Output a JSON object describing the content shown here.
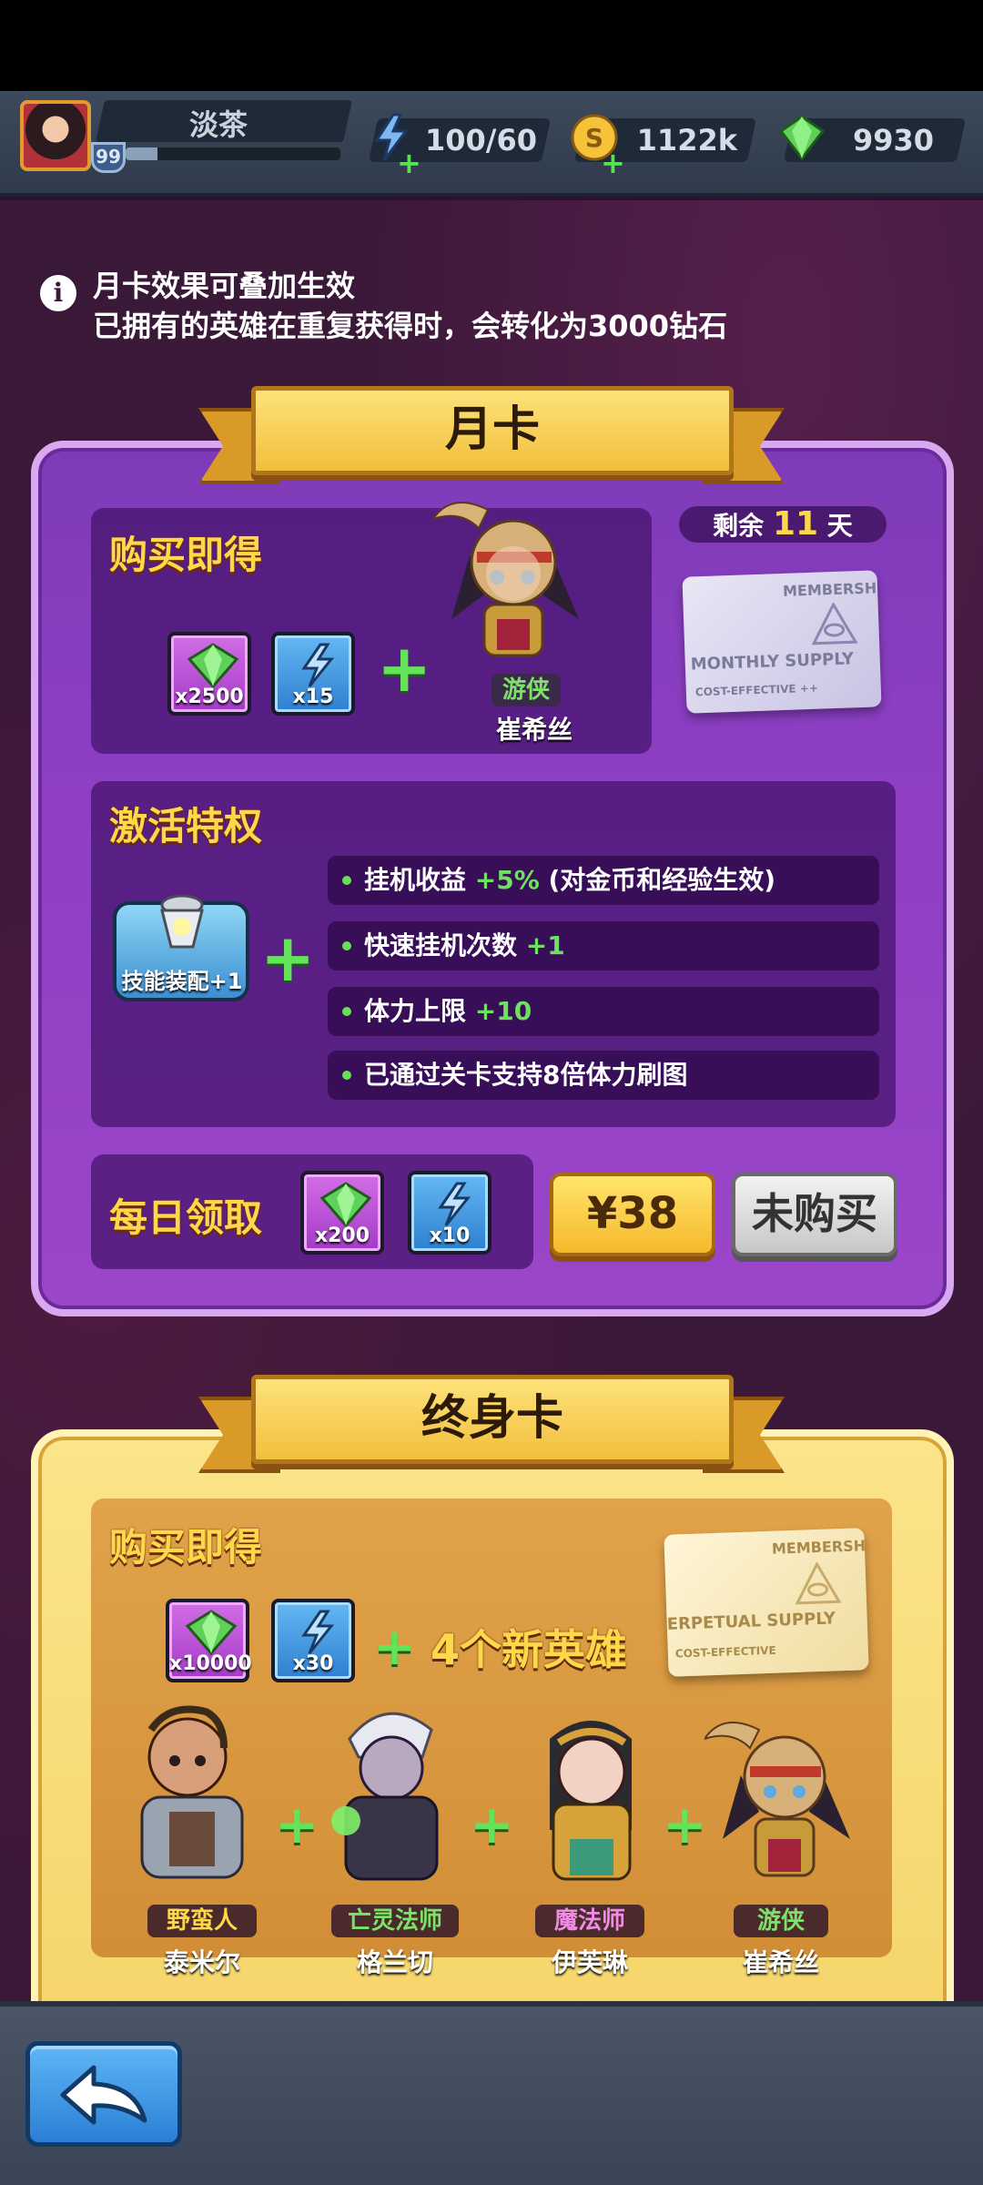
{
  "player": {
    "name": "淡茶",
    "level": "99",
    "exp_fraction": 0.15
  },
  "resources": {
    "stamina": "100/60",
    "gold": "1122k",
    "gems": "9930"
  },
  "notice": {
    "line1": "月卡效果可叠加生效",
    "line2": "已拥有的英雄在重复获得时，会转化为3000钻石"
  },
  "monthly": {
    "title": "月卡",
    "purchase_title": "购买即得",
    "days_prefix": "剩余",
    "days_value": "11",
    "days_suffix": "天",
    "rewards": [
      {
        "qty": "x2500",
        "type": "gem"
      },
      {
        "qty": "x15",
        "type": "stamina"
      }
    ],
    "hero": {
      "class": "游侠",
      "name": "崔希丝"
    },
    "card_text_top": "MEMBERSHI",
    "card_text_main": "MONTHLY SUPPLY",
    "card_text_bottom": "COST-EFFECTIVE ++",
    "privilege_title": "激活特权",
    "skill_label": "技能装配+1",
    "perks": [
      {
        "text": "挂机收益 ",
        "bonus": "+5%",
        "note": " (对金币和经验生效)"
      },
      {
        "text": "快速挂机次数 ",
        "bonus": "+1",
        "note": ""
      },
      {
        "text": "体力上限 ",
        "bonus": "+10",
        "note": ""
      },
      {
        "text": "已通过关卡支持8倍体力刷图",
        "bonus": "",
        "note": ""
      }
    ],
    "daily_title": "每日领取",
    "daily_rewards": [
      {
        "qty": "x200",
        "type": "gem"
      },
      {
        "qty": "x10",
        "type": "stamina"
      }
    ],
    "price": "¥38",
    "status": "未购买"
  },
  "lifetime": {
    "title": "终身卡",
    "purchase_title": "购买即得",
    "rewards": [
      {
        "qty": "x10000",
        "type": "gem"
      },
      {
        "qty": "x30",
        "type": "stamina"
      }
    ],
    "new_heroes_plus": "+",
    "new_heroes_text": "4个新英雄",
    "card_text_top": "MEMBERSHI",
    "card_text_main": "ERPETUAL SUPPLY",
    "card_text_bottom": "COST-EFFECTIVE",
    "heroes": [
      {
        "class": "野蛮人",
        "name": "泰米尔",
        "class_color": "#ffd84a"
      },
      {
        "class": "亡灵法师",
        "name": "格兰切",
        "class_color": "#7fe06a"
      },
      {
        "class": "魔法师",
        "name": "伊芙琳",
        "class_color": "#f08ae6"
      },
      {
        "class": "游侠",
        "name": "崔希丝",
        "class_color": "#7fe06a"
      }
    ]
  },
  "colors": {
    "accent_gold": "#ffd84a",
    "bonus_green": "#6be35e",
    "monthly_purple": "#8e3fc4",
    "lifetime_gold": "#f5d56a"
  }
}
